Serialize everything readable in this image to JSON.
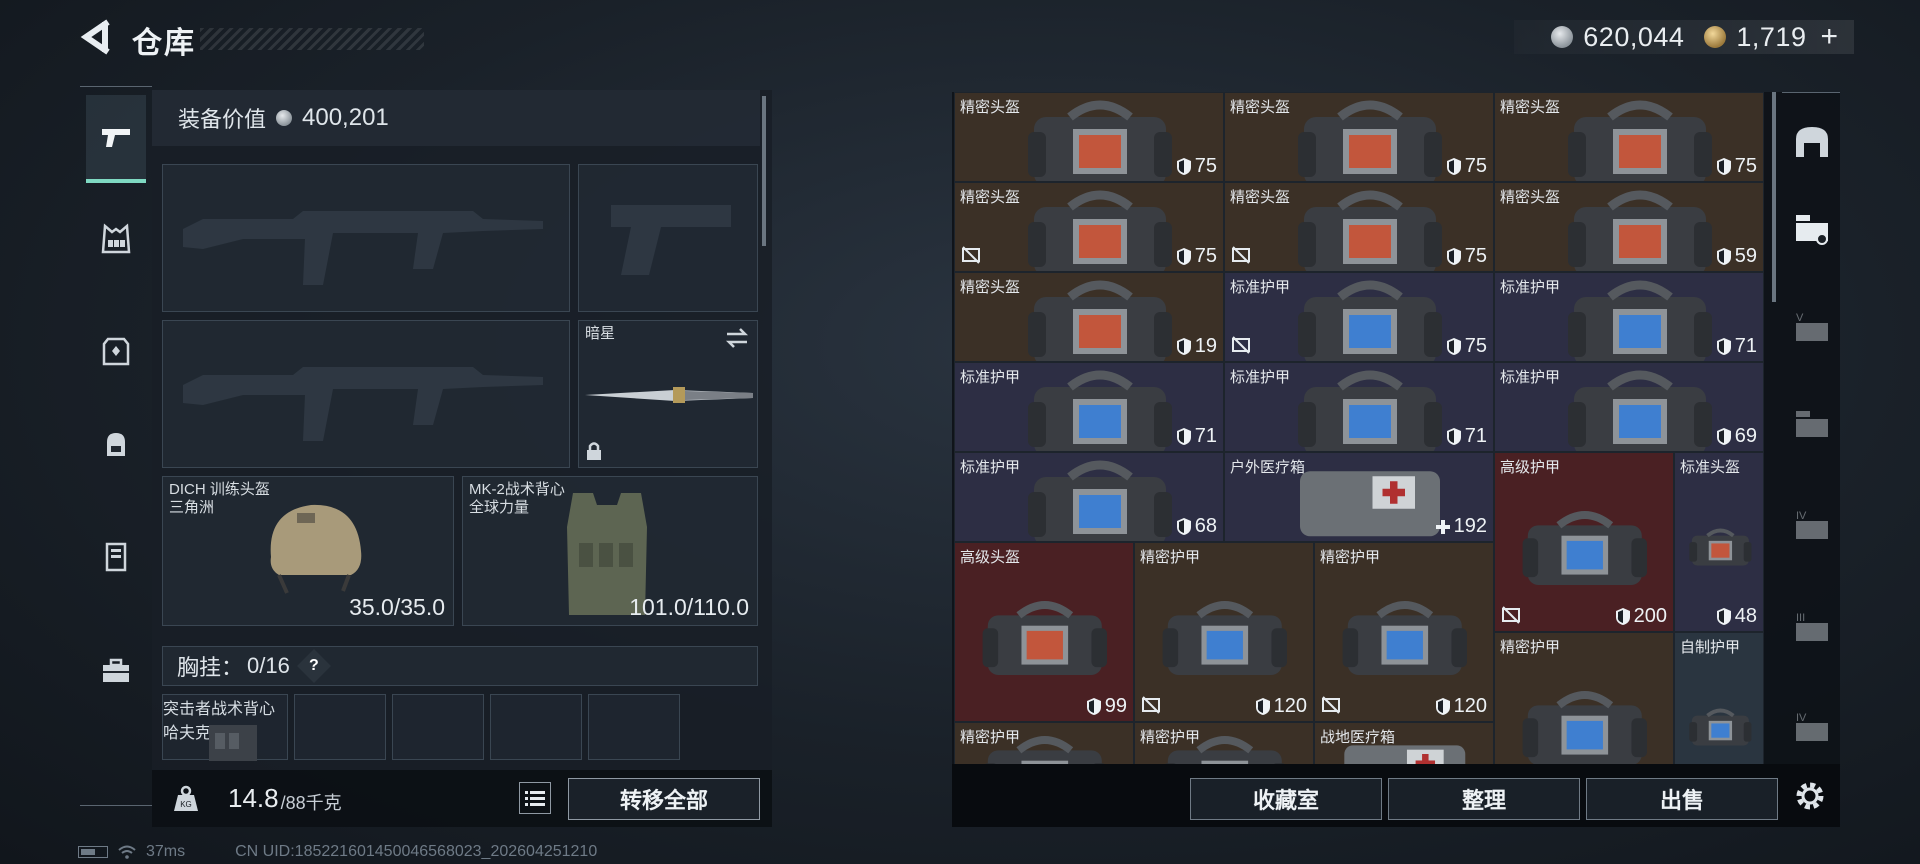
{
  "header": {
    "title": "仓库",
    "currency_silver": "620,044",
    "currency_gold": "1,719",
    "currency_plus": "+"
  },
  "left_nav": {
    "items": [
      {
        "icon": "pistol-icon",
        "active": true
      },
      {
        "icon": "chest-rig-icon",
        "active": false
      },
      {
        "icon": "backpack-icon",
        "active": false
      },
      {
        "icon": "helmet-icon",
        "active": false
      },
      {
        "icon": "locker-icon",
        "active": false
      },
      {
        "icon": "toolbox-icon",
        "active": false
      }
    ]
  },
  "equipment": {
    "value_label": "装备价值",
    "value": "400,201",
    "melee_name": "暗星",
    "helmet": {
      "name": "DICH 训练头盔",
      "sub": "三角洲",
      "durability": "35.0/35.0"
    },
    "armor": {
      "name": "MK-2战术背心",
      "sub": "全球力量",
      "durability": "101.0/110.0"
    },
    "vest_label": "胸挂：",
    "vest_count": "0/16",
    "help": "?",
    "vest_item": {
      "name": "突击者战术背心",
      "sub": "哈夫克"
    },
    "weight": "14.8",
    "weight_cap": "/88千克",
    "transfer_all": "转移全部"
  },
  "stash": {
    "cells": [
      {
        "name": "精密头盔",
        "value": "75",
        "type": "helmet",
        "color": "brown",
        "nodrop": false
      },
      {
        "name": "精密头盔",
        "value": "75",
        "type": "helmet",
        "color": "brown",
        "nodrop": false
      },
      {
        "name": "精密头盔",
        "value": "75",
        "type": "helmet",
        "color": "brown",
        "nodrop": false
      },
      {
        "name": "精密头盔",
        "value": "75",
        "type": "helmet",
        "color": "brown",
        "nodrop": true
      },
      {
        "name": "精密头盔",
        "value": "75",
        "type": "helmet",
        "color": "brown",
        "nodrop": true
      },
      {
        "name": "精密头盔",
        "value": "59",
        "type": "helmet",
        "color": "brown",
        "nodrop": false
      },
      {
        "name": "精密头盔",
        "value": "19",
        "type": "helmet",
        "color": "brown",
        "nodrop": false
      },
      {
        "name": "标准护甲",
        "value": "75",
        "type": "armor",
        "color": "navy",
        "nodrop": true
      },
      {
        "name": "标准护甲",
        "value": "71",
        "type": "armor",
        "color": "navy",
        "nodrop": false
      },
      {
        "name": "标准护甲",
        "value": "71",
        "type": "armor",
        "color": "navy",
        "nodrop": false
      },
      {
        "name": "标准护甲",
        "value": "71",
        "type": "armor",
        "color": "navy",
        "nodrop": false
      },
      {
        "name": "标准护甲",
        "value": "69",
        "type": "armor",
        "color": "navy",
        "nodrop": false
      },
      {
        "name": "标准护甲",
        "value": "68",
        "type": "armor",
        "color": "navy",
        "nodrop": false
      },
      {
        "name": "户外医疗箱",
        "value": "192",
        "type": "medkit",
        "color": "navy",
        "nodrop": false
      },
      {
        "name": "高级护甲",
        "value": "200",
        "type": "armor",
        "color": "red",
        "nodrop": true
      },
      {
        "name": "标准头盔",
        "value": "48",
        "type": "helmet",
        "color": "navy",
        "nodrop": false
      },
      {
        "name": "高级头盔",
        "value": "99",
        "type": "helmet",
        "color": "red",
        "nodrop": false
      },
      {
        "name": "精密护甲",
        "value": "120",
        "type": "armor",
        "color": "brown",
        "nodrop": true
      },
      {
        "name": "精密护甲",
        "value": "120",
        "type": "armor",
        "color": "brown",
        "nodrop": true
      },
      {
        "name": "精密护甲",
        "value": "",
        "type": "armor",
        "color": "brown",
        "nodrop": false
      },
      {
        "name": "自制护甲",
        "value": "",
        "type": "armor",
        "color": "teal",
        "nodrop": false
      },
      {
        "name": "精密护甲",
        "value": "",
        "type": "armor",
        "color": "brown",
        "nodrop": false
      },
      {
        "name": "精密护甲",
        "value": "",
        "type": "armor",
        "color": "brown",
        "nodrop": false
      },
      {
        "name": "战地医疗箱",
        "value": "",
        "type": "medkit",
        "color": "brown",
        "nodrop": false
      }
    ],
    "buttons": {
      "collection": "收藏室",
      "sort": "整理",
      "sell": "出售"
    }
  },
  "status": {
    "ping": "37ms",
    "uid": "CN UID:1852216014500465680​23_202604251210"
  },
  "colors": {
    "accent": "#7fd9c2",
    "brown": "#3b3026",
    "navy": "#2d2e44",
    "red": "#4a2023"
  }
}
